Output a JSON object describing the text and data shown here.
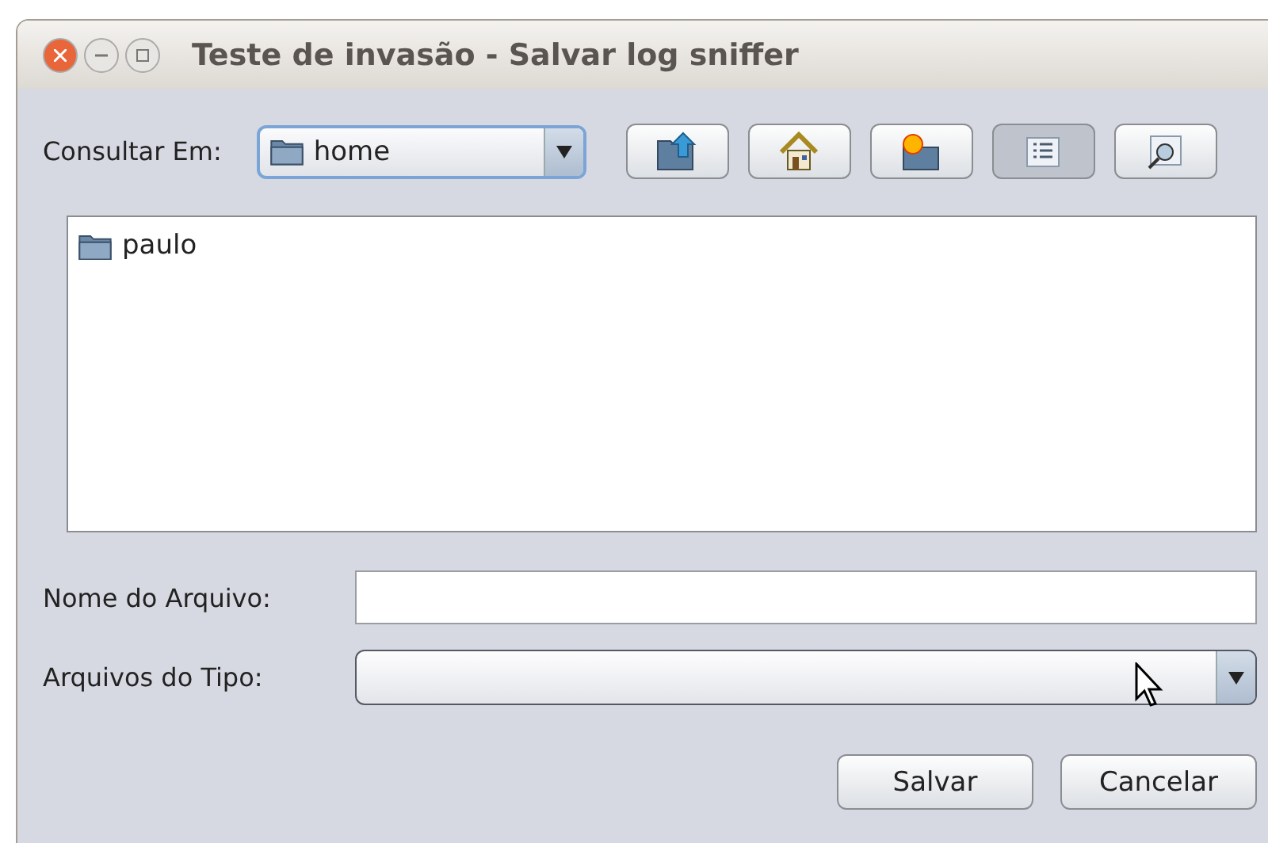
{
  "window": {
    "title": "Teste de invasão - Salvar log sniffer"
  },
  "look_in": {
    "label": "Consultar Em:",
    "value": "home"
  },
  "toolbar": [
    {
      "kind": "up",
      "selected": false
    },
    {
      "kind": "home",
      "selected": false
    },
    {
      "kind": "new-folder",
      "selected": false
    },
    {
      "kind": "list",
      "selected": true
    },
    {
      "kind": "details",
      "selected": false
    }
  ],
  "files": [
    {
      "name": "paulo",
      "kind": "folder"
    }
  ],
  "file_name": {
    "label": "Nome do Arquivo:"
  },
  "file_type": {
    "label": "Arquivos do Tipo:"
  },
  "buttons": [
    {
      "label": "Salvar"
    },
    {
      "label": "Cancelar"
    }
  ]
}
